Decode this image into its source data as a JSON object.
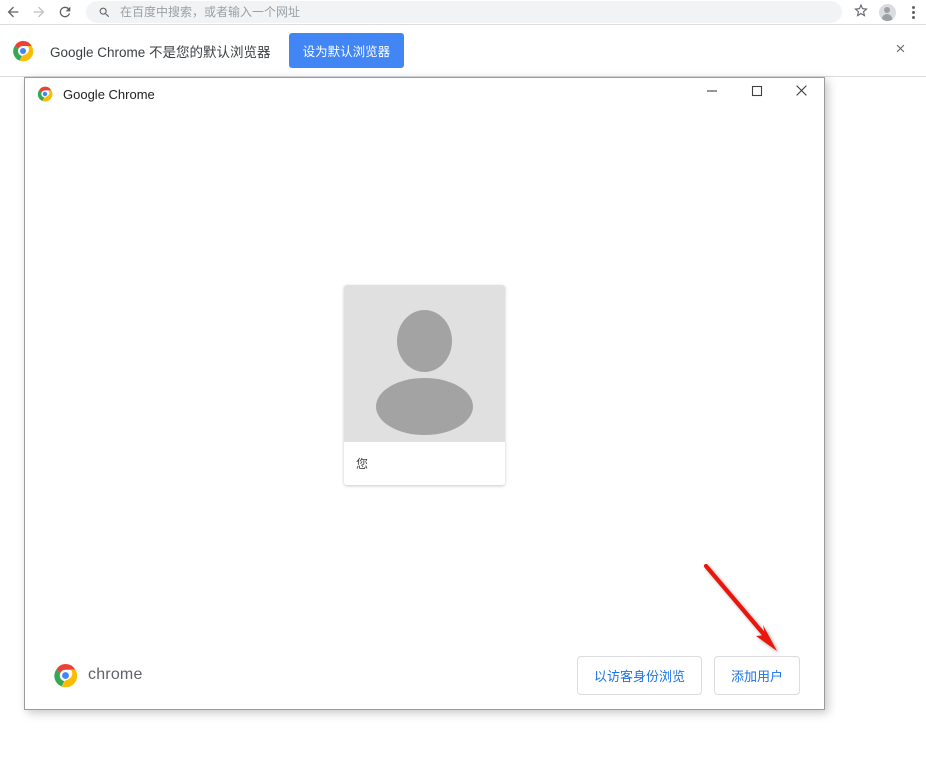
{
  "browser": {
    "toolbar": {
      "back_icon": "back-arrow-icon",
      "forward_icon": "forward-arrow-icon",
      "reload_icon": "reload-icon",
      "omnibox_placeholder": "在百度中搜索，或者输入一个网址",
      "omnibox_value": "",
      "search_icon": "search-icon",
      "bookmark_icon": "star-icon",
      "profile_icon": "profile-avatar-icon",
      "menu_icon": "kebab-menu-icon"
    },
    "infobar": {
      "logo_icon": "chrome-logo-icon",
      "message": "Google Chrome 不是您的默认浏览器",
      "cta_label": "设为默认浏览器",
      "cta_color": "#4285f4",
      "close_icon": "close-icon"
    }
  },
  "picker_window": {
    "titlebar": {
      "logo_icon": "chrome-logo-icon",
      "title": "Google Chrome",
      "minimize_icon": "minimize-icon",
      "maximize_icon": "maximize-icon",
      "close_icon": "close-icon"
    },
    "profiles": [
      {
        "name": "您",
        "avatar_icon": "generic-person-avatar-icon",
        "avatar_bg": "#e0e0e0",
        "avatar_fg": "#a3a3a3"
      }
    ],
    "footer": {
      "brand_logo_icon": "chrome-logo-icon",
      "brand_word": "chrome",
      "guest_label": "以访客身份浏览",
      "add_user_label": "添加用户",
      "link_color": "#1a73e8"
    }
  },
  "annotation": {
    "arrow_icon": "red-arrow-icon",
    "arrow_color": "#e8140c",
    "points_to": "添加用户"
  }
}
